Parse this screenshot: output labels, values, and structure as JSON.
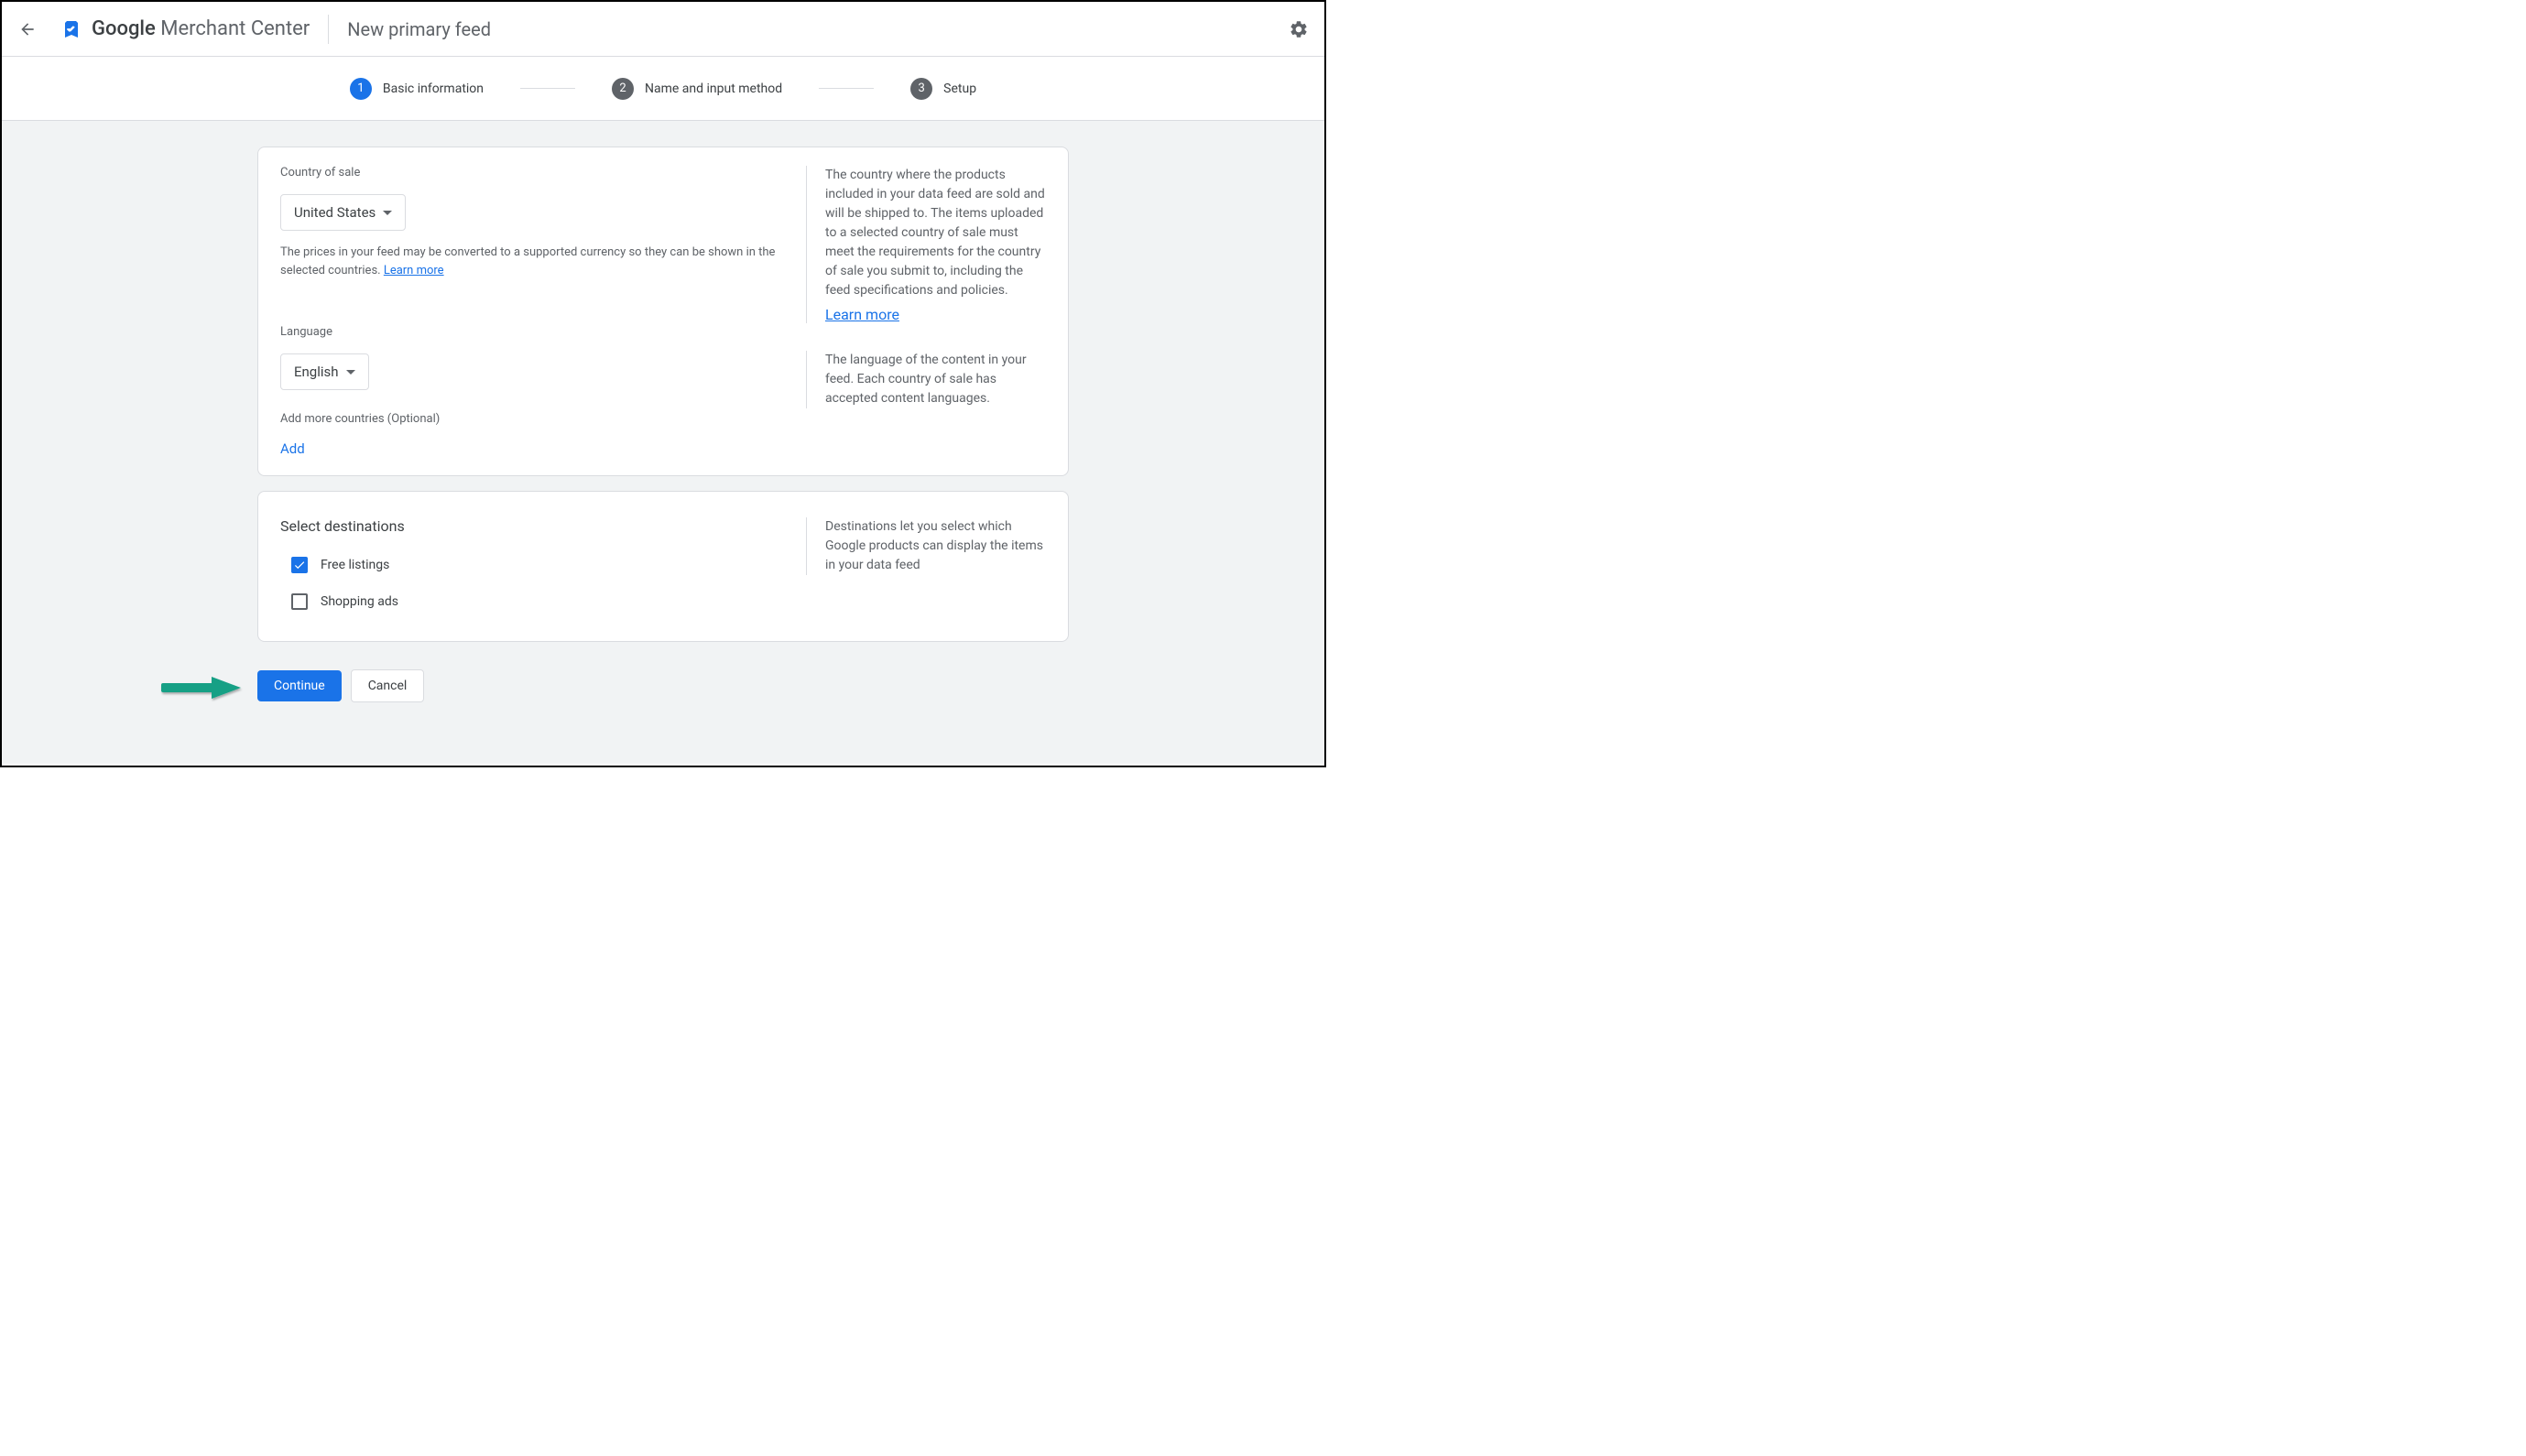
{
  "header": {
    "logo_prefix": "Google",
    "logo_suffix": " Merchant Center",
    "page_title": "New primary feed"
  },
  "stepper": {
    "s1": {
      "num": "1",
      "label": "Basic information"
    },
    "s2": {
      "num": "2",
      "label": "Name and input method"
    },
    "s3": {
      "num": "3",
      "label": "Setup"
    }
  },
  "country": {
    "label": "Country of sale",
    "selected": "United States",
    "helper": "The prices in your feed may be converted to a supported currency so they can be shown in the selected countries. ",
    "learn_more": "Learn more",
    "info": "The country where the products included in your data feed are sold and will be shipped to. The items uploaded to a selected country of sale must meet the requirements for the country of sale you submit to, including the feed specifications and policies.",
    "info_link": "Learn more"
  },
  "language": {
    "label": "Language",
    "selected": "English",
    "info": "The language of the content in your feed. Each country of sale has accepted content languages."
  },
  "add_countries": {
    "label": "Add more countries (Optional)",
    "add": "Add"
  },
  "destinations": {
    "title": "Select destinations",
    "free_listings": "Free listings",
    "shopping_ads": "Shopping ads",
    "info": "Destinations let you select which Google products can display the items in your data feed"
  },
  "actions": {
    "continue": "Continue",
    "cancel": "Cancel"
  }
}
